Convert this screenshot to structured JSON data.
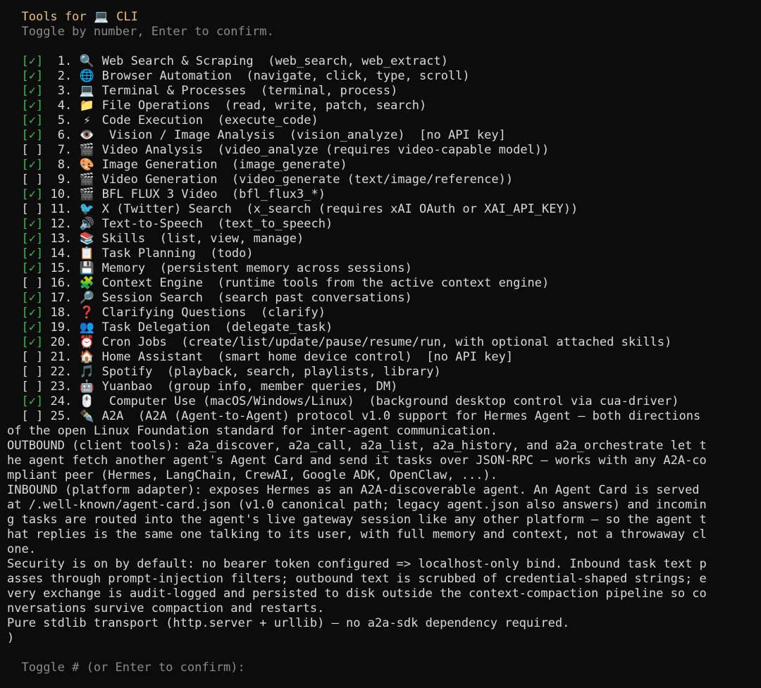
{
  "header": {
    "title_prefix": "Tools for",
    "title_icon": "💻",
    "title_suffix": "CLI",
    "subtitle": "Toggle by number, Enter to confirm."
  },
  "tools": [
    {
      "checked": true,
      "num": "1.",
      "icon": "🔍",
      "name": "Web Search & Scraping",
      "detail": "(web_search, web_extract)"
    },
    {
      "checked": true,
      "num": "2.",
      "icon": "🌐",
      "name": "Browser Automation",
      "detail": "(navigate, click, type, scroll)"
    },
    {
      "checked": true,
      "num": "3.",
      "icon": "💻",
      "name": "Terminal & Processes",
      "detail": "(terminal, process)"
    },
    {
      "checked": true,
      "num": "4.",
      "icon": "📁",
      "name": "File Operations",
      "detail": "(read, write, patch, search)"
    },
    {
      "checked": true,
      "num": "5.",
      "icon": "⚡",
      "name": "Code Execution",
      "detail": "(execute_code)"
    },
    {
      "checked": true,
      "num": "6.",
      "icon": "👁️",
      "name": " Vision / Image Analysis",
      "detail": "(vision_analyze)  [no API key]"
    },
    {
      "checked": false,
      "num": "7.",
      "icon": "🎬",
      "name": "Video Analysis",
      "detail": "(video_analyze (requires video-capable model))"
    },
    {
      "checked": true,
      "num": "8.",
      "icon": "🎨",
      "name": "Image Generation",
      "detail": "(image_generate)"
    },
    {
      "checked": false,
      "num": "9.",
      "icon": "🎬",
      "name": "Video Generation",
      "detail": "(video_generate (text/image/reference))"
    },
    {
      "checked": true,
      "num": "10.",
      "icon": "🎬",
      "name": "BFL FLUX 3 Video",
      "detail": "(bfl_flux3_*)"
    },
    {
      "checked": false,
      "num": "11.",
      "icon": "🐦",
      "name": "X (Twitter) Search",
      "detail": "(x_search (requires xAI OAuth or XAI_API_KEY))"
    },
    {
      "checked": true,
      "num": "12.",
      "icon": "🔊",
      "name": "Text-to-Speech",
      "detail": "(text_to_speech)"
    },
    {
      "checked": true,
      "num": "13.",
      "icon": "📚",
      "name": "Skills",
      "detail": "(list, view, manage)"
    },
    {
      "checked": true,
      "num": "14.",
      "icon": "📋",
      "name": "Task Planning",
      "detail": "(todo)"
    },
    {
      "checked": true,
      "num": "15.",
      "icon": "💾",
      "name": "Memory",
      "detail": "(persistent memory across sessions)"
    },
    {
      "checked": false,
      "num": "16.",
      "icon": "🧩",
      "name": "Context Engine",
      "detail": "(runtime tools from the active context engine)"
    },
    {
      "checked": true,
      "num": "17.",
      "icon": "🔎",
      "name": "Session Search",
      "detail": "(search past conversations)"
    },
    {
      "checked": true,
      "num": "18.",
      "icon": "❓",
      "name": "Clarifying Questions",
      "detail": "(clarify)"
    },
    {
      "checked": true,
      "num": "19.",
      "icon": "👥",
      "name": "Task Delegation",
      "detail": "(delegate_task)"
    },
    {
      "checked": true,
      "num": "20.",
      "icon": "⏰",
      "name": "Cron Jobs",
      "detail": "(create/list/update/pause/resume/run, with optional attached skills)"
    },
    {
      "checked": false,
      "num": "21.",
      "icon": "🏠",
      "name": "Home Assistant",
      "detail": "(smart home device control)  [no API key]"
    },
    {
      "checked": false,
      "num": "22.",
      "icon": "🎵",
      "name": "Spotify",
      "detail": "(playback, search, playlists, library)"
    },
    {
      "checked": false,
      "num": "23.",
      "icon": "🤖",
      "name": "Yuanbao",
      "detail": "(group info, member queries, DM)"
    },
    {
      "checked": true,
      "num": "24.",
      "icon": "🖱️",
      "name": " Computer Use (macOS/Windows/Linux)",
      "detail": "(background desktop control via cua-driver)"
    },
    {
      "checked": false,
      "num": "25.",
      "icon": "✒️",
      "name": "A2A",
      "detail": "(A2A (Agent-to-Agent) protocol v1.0 support for Hermes Agent — both directions"
    }
  ],
  "a2a_description": [
    "of the open Linux Foundation standard for inter-agent communication.",
    "OUTBOUND (client tools): a2a_discover, a2a_call, a2a_list, a2a_history, and a2a_orchestrate let t",
    "he agent fetch another agent's Agent Card and send it tasks over JSON-RPC — works with any A2A-co",
    "mpliant peer (Hermes, LangChain, CrewAI, Google ADK, OpenClaw, ...).",
    "INBOUND (platform adapter): exposes Hermes as an A2A-discoverable agent. An Agent Card is served",
    "at /.well-known/agent-card.json (v1.0 canonical path; legacy agent.json also answers) and incomin",
    "g tasks are routed into the agent's live gateway session like any other platform — so the agent t",
    "hat replies is the same one talking to its user, with full memory and context, not a throwaway cl",
    "one.",
    "Security is on by default: no bearer token configured => localhost-only bind. Inbound task text p",
    "asses through prompt-injection filters; outbound text is scrubbed of credential-shaped strings; e",
    "very exchange is audit-logged and persisted to disk outside the context-compaction pipeline so co",
    "nversations survive compaction and restarts.",
    "Pure stdlib transport (http.server + urllib) — no a2a-sdk dependency required.",
    ")"
  ],
  "checkbox_on": "[✓]",
  "checkbox_off": "[ ]",
  "prompt": "Toggle # (or Enter to confirm):",
  "colors": {
    "background": "#0c0c0c",
    "text": "#d9d9d9",
    "checked": "#3fb950",
    "header": "#e5c07b",
    "muted": "#8a8a8a"
  }
}
